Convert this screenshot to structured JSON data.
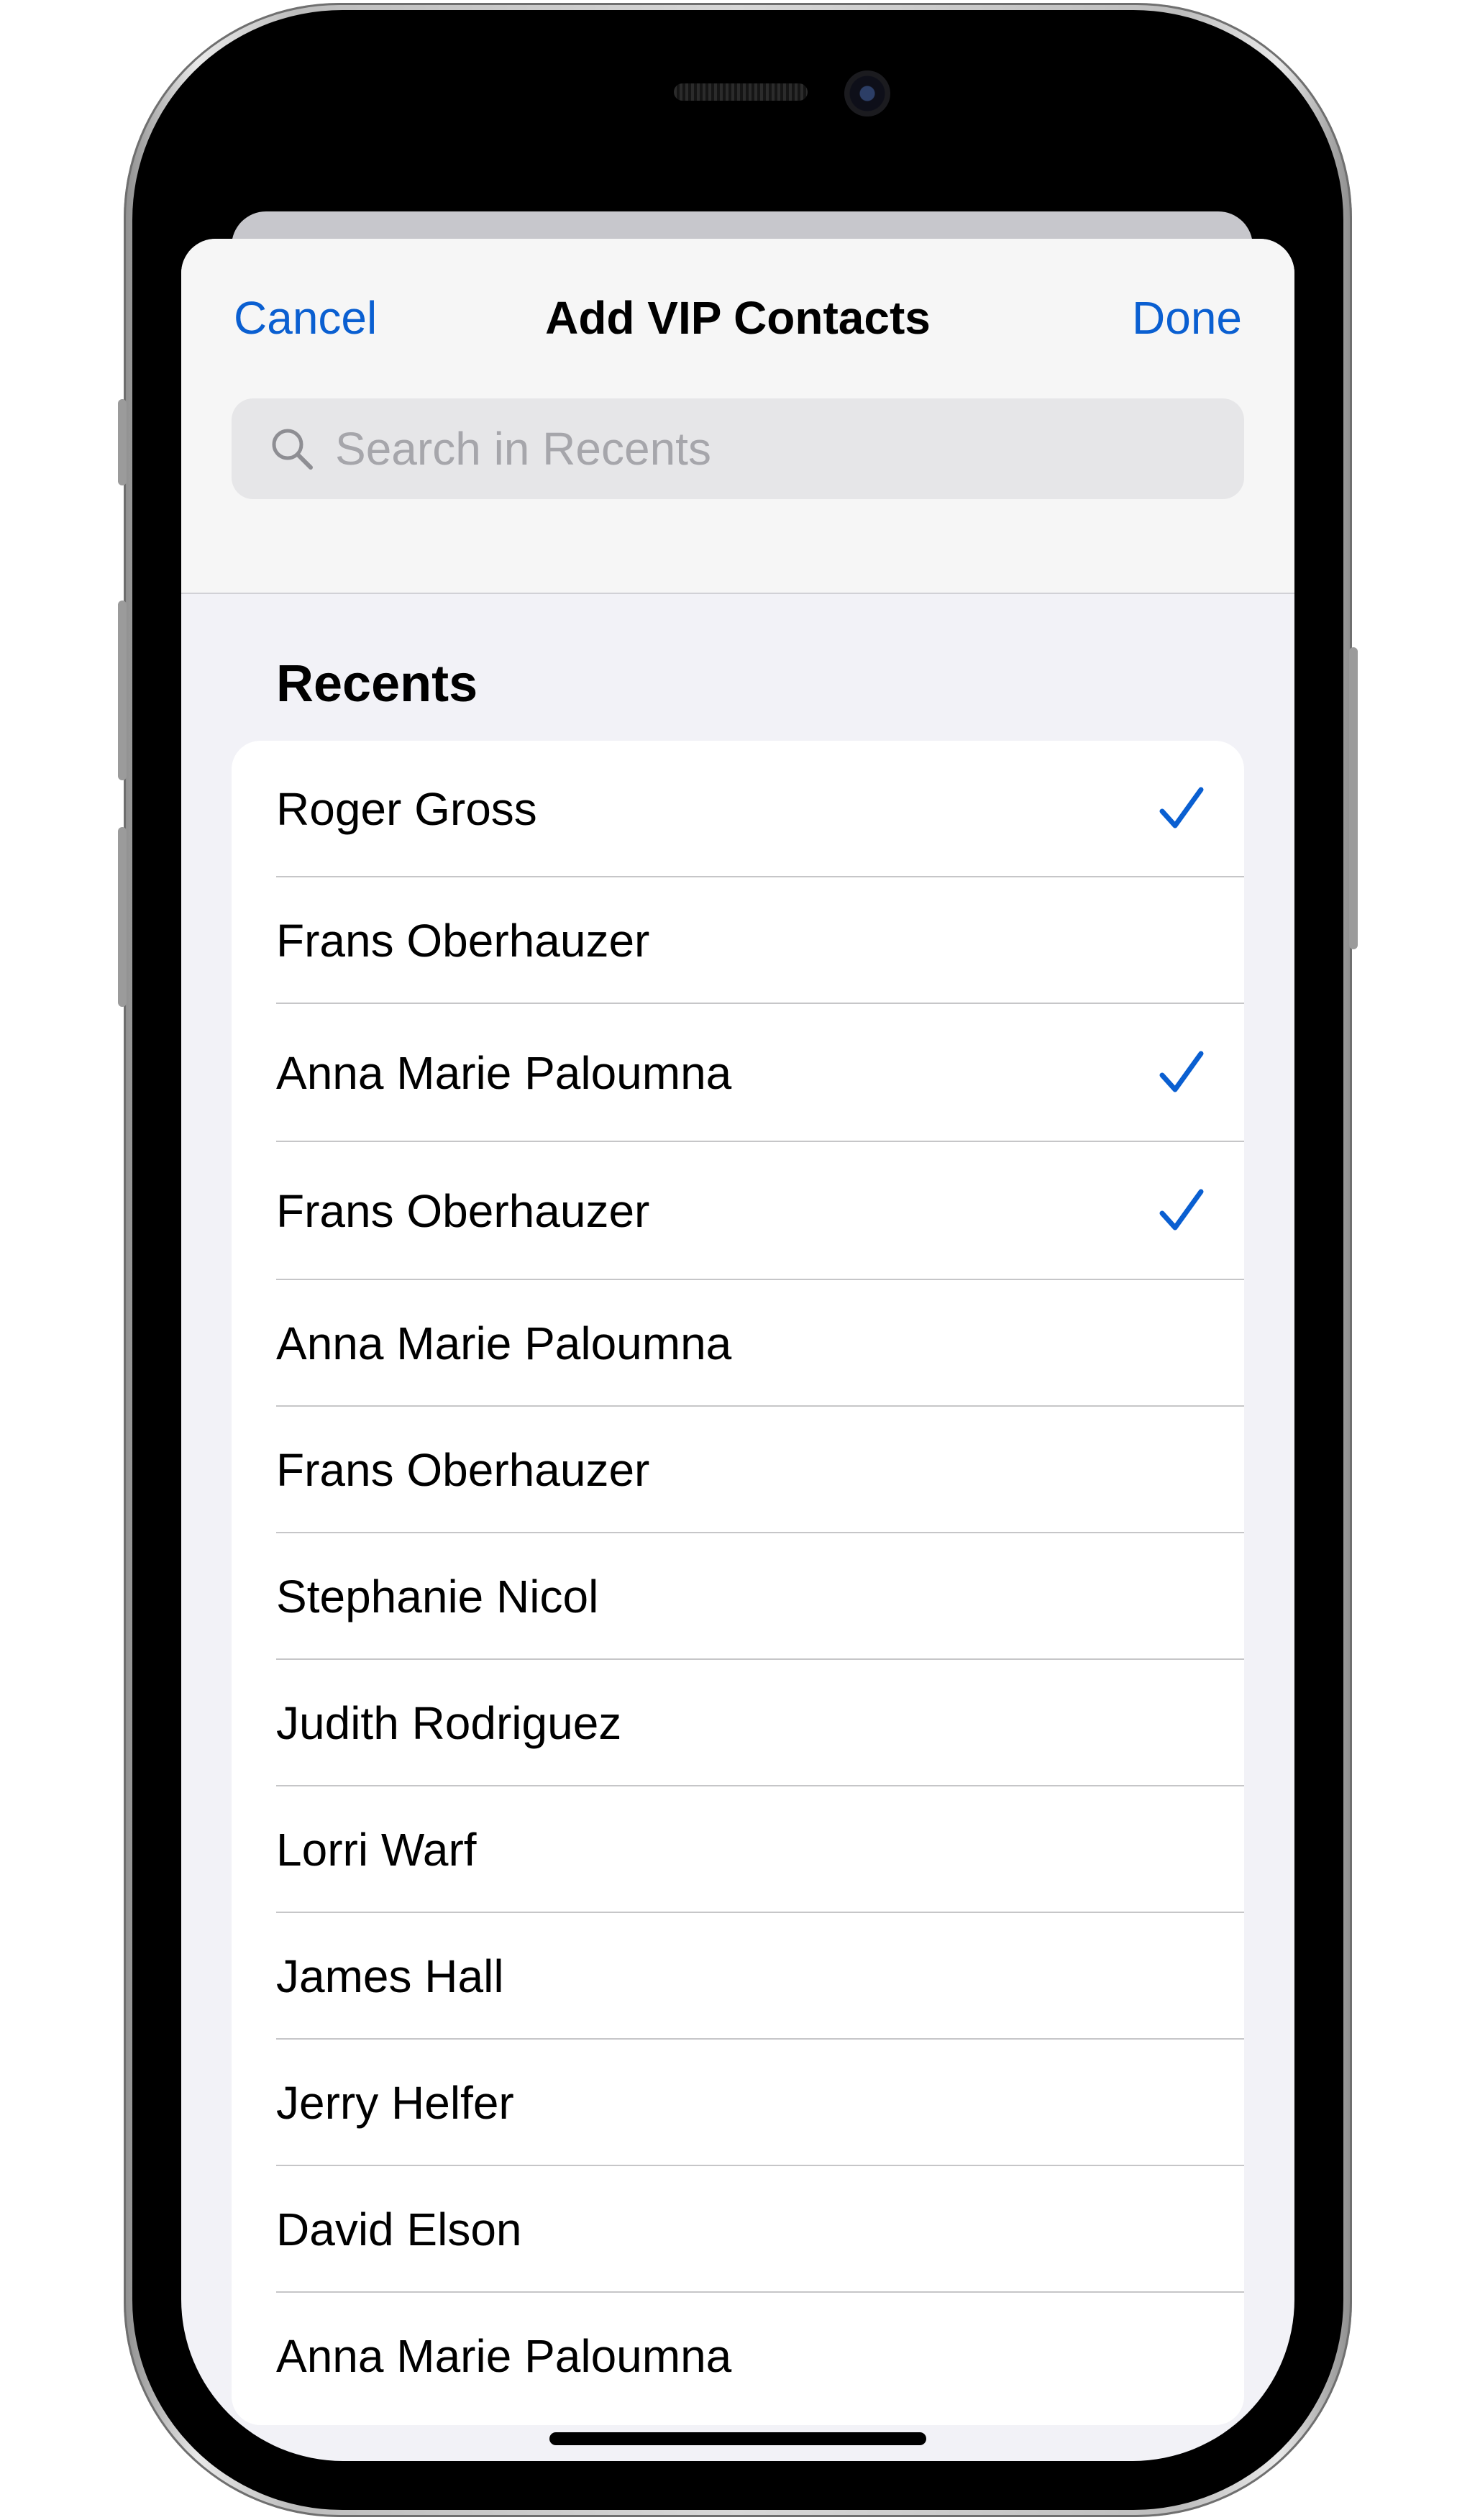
{
  "header": {
    "cancel_label": "Cancel",
    "title": "Add VIP Contacts",
    "done_label": "Done"
  },
  "search": {
    "placeholder": "Search in Recents",
    "icon": "magnifying-glass-icon"
  },
  "section": {
    "title": "Recents"
  },
  "contacts": [
    {
      "name": "Roger Gross",
      "selected": true
    },
    {
      "name": "Frans Oberhauzer",
      "selected": false
    },
    {
      "name": "Anna Marie Paloumna",
      "selected": true
    },
    {
      "name": "Frans Oberhauzer",
      "selected": true
    },
    {
      "name": "Anna Marie Paloumna",
      "selected": false
    },
    {
      "name": "Frans Oberhauzer",
      "selected": false
    },
    {
      "name": "Stephanie Nicol",
      "selected": false
    },
    {
      "name": "Judith Rodriguez",
      "selected": false
    },
    {
      "name": "Lorri Warf",
      "selected": false
    },
    {
      "name": "James Hall",
      "selected": false
    },
    {
      "name": "Jerry Helfer",
      "selected": false
    },
    {
      "name": "David Elson",
      "selected": false
    },
    {
      "name": "Anna Marie Paloumna",
      "selected": false
    }
  ],
  "colors": {
    "accent": "#0a5fd1",
    "sheet_background": "#f2f2f7",
    "card_background": "#ffffff",
    "separator": "#c6c6c8"
  }
}
